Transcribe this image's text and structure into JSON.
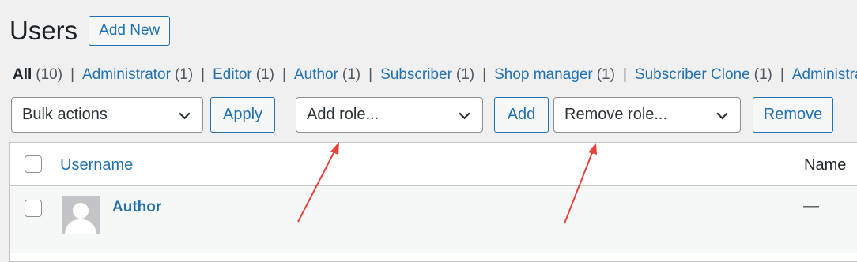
{
  "page": {
    "title": "Users",
    "add_new_label": "Add New"
  },
  "filters": [
    {
      "label": "All",
      "count": "(10)",
      "current": true
    },
    {
      "label": "Administrator",
      "count": "(1)"
    },
    {
      "label": "Editor",
      "count": "(1)"
    },
    {
      "label": "Author",
      "count": "(1)"
    },
    {
      "label": "Subscriber",
      "count": "(1)"
    },
    {
      "label": "Shop manager",
      "count": "(1)"
    },
    {
      "label": "Subscriber Clone",
      "count": "(1)"
    },
    {
      "label": "Administra",
      "count": ""
    }
  ],
  "filter_separator": "|",
  "tablenav": {
    "bulk_actions": "Bulk actions",
    "apply_label": "Apply",
    "add_role": "Add role...",
    "add_label": "Add",
    "remove_role": "Remove role...",
    "remove_label": "Remove"
  },
  "table": {
    "columns": {
      "username": "Username",
      "name": "Name"
    },
    "rows": [
      {
        "username": "Author",
        "name": "—"
      }
    ]
  },
  "colors": {
    "accent": "#2271b1",
    "annotation_arrow": "#e8413a",
    "background": "#f0f0f1"
  },
  "icons": {
    "select_chevron": "chevron-down-icon",
    "avatar": "default-avatar-icon",
    "annotation": "arrow-annotation-icon"
  }
}
